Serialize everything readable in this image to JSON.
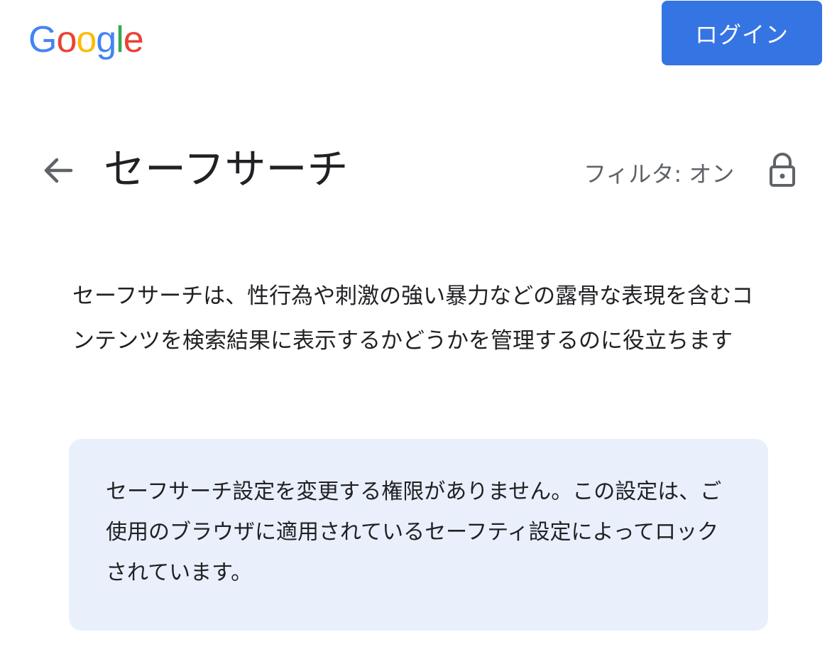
{
  "header": {
    "logo_letters": [
      {
        "char": "G",
        "color": "#4285F4"
      },
      {
        "char": "o",
        "color": "#EA4335"
      },
      {
        "char": "o",
        "color": "#FBBC05"
      },
      {
        "char": "g",
        "color": "#4285F4"
      },
      {
        "char": "l",
        "color": "#34A853"
      },
      {
        "char": "e",
        "color": "#EA4335"
      }
    ],
    "login_label": "ログイン",
    "accent_color": "#3574e3"
  },
  "title_row": {
    "back_icon": "arrow-left-icon",
    "title": "セーフサーチ",
    "filter_status": "フィルタ: オン",
    "lock_icon": "lock-icon"
  },
  "description": "セーフサーチは、性行為や刺激の強い暴力などの露骨な表現を含むコンテンツを検索結果に表示するかどうかを管理するのに役立ちます",
  "notice": {
    "text": "セーフサーチ設定を変更する権限がありません。この設定は、ご使用のブラウザに適用されているセーフティ設定によってロックされています。",
    "background_color": "#e9f0fc"
  }
}
